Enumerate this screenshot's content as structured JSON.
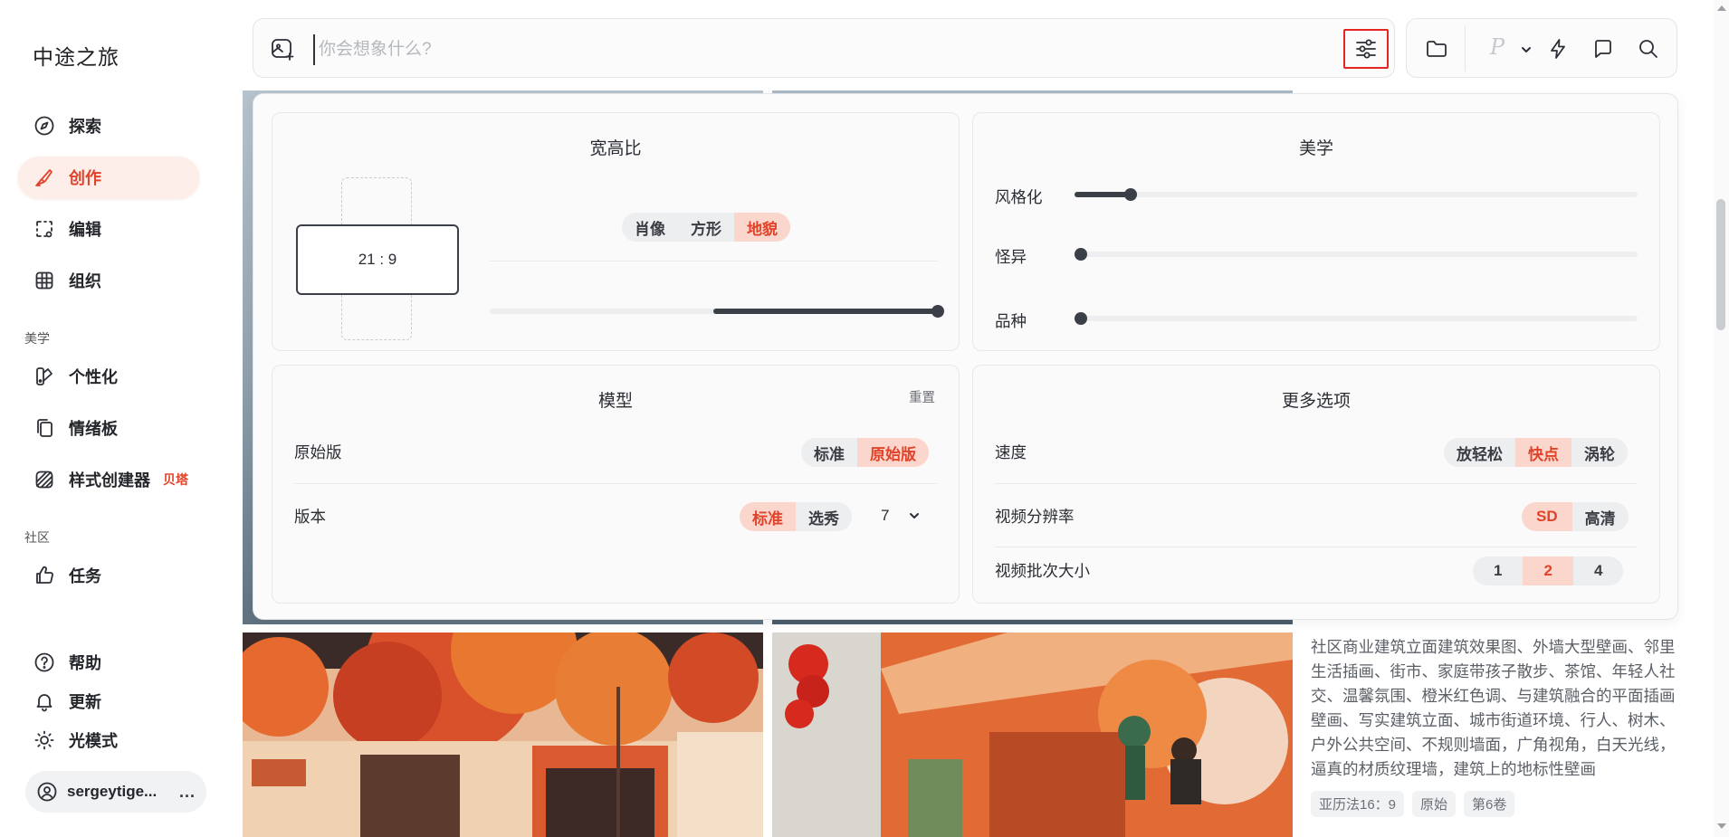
{
  "brand": "中途之旅",
  "nav": {
    "explore": "探索",
    "create": "创作",
    "edit": "编辑",
    "organize": "组织",
    "aesthetics_section": "美学",
    "personalize": "个性化",
    "moodboard": "情绪板",
    "style_creator": "样式创建器",
    "style_creator_badge": "贝塔",
    "community_section": "社区",
    "tasks": "任务",
    "help": "帮助",
    "updates": "更新",
    "light_mode": "光模式",
    "username": "sergeytige...",
    "more": "..."
  },
  "search": {
    "placeholder": "你会想象什么?"
  },
  "toolbar": {
    "p_label": "P"
  },
  "panel": {
    "aspect": {
      "title": "宽高比",
      "ratio_label": "21 : 9",
      "options": [
        "肖像",
        "方形",
        "地貌"
      ],
      "selected": "地貌",
      "slider_value": 1.0
    },
    "aesthetics": {
      "title": "美学",
      "stylize_label": "风格化",
      "stylize_value": 0.1,
      "weird_label": "怪异",
      "weird_value": 0,
      "variety_label": "品种",
      "variety_value": 0
    },
    "model": {
      "title": "模型",
      "reset": "重置",
      "raw_label": "原始版",
      "raw_options": [
        "标准",
        "原始版"
      ],
      "raw_selected": "原始版",
      "version_label": "版本",
      "version_options": [
        "标准",
        "选秀"
      ],
      "version_selected": "标准",
      "version_number": "7"
    },
    "more": {
      "title": "更多选项",
      "speed_label": "速度",
      "speed_options": [
        "放轻松",
        "快点",
        "涡轮"
      ],
      "speed_selected": "快点",
      "video_res_label": "视频分辨率",
      "video_res_options": [
        "SD",
        "高清"
      ],
      "video_res_selected": "SD",
      "video_batch_label": "视频批次大小",
      "video_batch_options": [
        "1",
        "2",
        "4"
      ],
      "video_batch_selected": "2"
    }
  },
  "gallery": {
    "description": "社区商业建筑立面建筑效果图、外墙大型壁画、邻里生活插画、街市、家庭带孩子散步、茶馆、年轻人社交、温馨氛围、橙米红色调、与建筑融合的平面插画壁画、写实建筑立面、城市街道环境、行人、树木、户外公共空间、不规则墙面，广角视角，白天光线，逼真的材质纹理墙，建筑上的地标性壁画",
    "tags": [
      "亚历法16：9",
      "原始",
      "第6卷"
    ]
  }
}
